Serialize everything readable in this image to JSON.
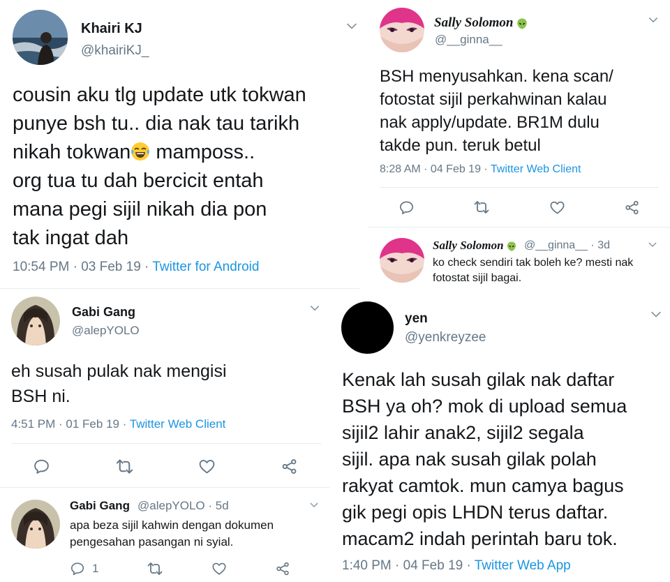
{
  "tweet1": {
    "name": "Khairi KJ",
    "handle": "@khairiKJ_",
    "lines": [
      "cousin aku tlg update utk tokwan",
      "punye bsh tu.. dia nak tau tarikh",
      "nikah tokwan",
      " mamposs..",
      "org tua tu dah bercicit entah",
      "mana pegi sijil nikah dia pon",
      "tak ingat dah"
    ],
    "time": "10:54 PM · 03 Feb 19 · ",
    "source": "Twitter for Android"
  },
  "tweet2": {
    "name": "Sally Solomon",
    "handle": "@__ginna__",
    "lines": [
      "BSH menyusahkan. kena scan/",
      "fotostat sijil perkahwinan kalau",
      "nak apply/update. BR1M dulu",
      "takde pun. teruk betul"
    ],
    "time": "8:28 AM · 04 Feb 19 · ",
    "source": "Twitter Web Client"
  },
  "reply2": {
    "name": "Sally Solomon",
    "meta": "@__ginna__ · 3d",
    "lines": [
      "ko check sendiri tak boleh ke? mesti nak",
      "fotostat sijil bagai."
    ]
  },
  "tweet3": {
    "name": "Gabi Gang",
    "handle": "@alepYOLO",
    "lines": [
      "eh susah pulak nak mengisi",
      "BSH ni."
    ],
    "time": "4:51 PM · 01 Feb 19 · ",
    "source": "Twitter Web Client"
  },
  "reply3": {
    "name": "Gabi Gang",
    "meta": "@alepYOLO · 5d",
    "lines": [
      "apa beza sijil kahwin dengan dokumen",
      "pengesahan pasangan ni syial."
    ],
    "reply_count": "1"
  },
  "tweet4": {
    "name": "yen",
    "handle": "@yenkreyzee",
    "lines": [
      "Kenak lah susah gilak nak daftar",
      "BSH ya oh? mok di upload semua",
      "sijil2 lahir anak2, sijil2 segala",
      "sijil. apa nak susah gilak polah",
      "rakyat camtok. mun camya bagus",
      "gik pegi opis LHDN terus daftar.",
      "macam2 indah perintah baru tok."
    ],
    "time": "1:40 PM · 04 Feb 19 · ",
    "source": "Twitter Web App"
  },
  "colors": {
    "link": "#1b95e0",
    "secondary": "#657786",
    "icon": "#657786"
  },
  "icons": {
    "chevron": "chevron-down-icon",
    "reply": "reply-icon",
    "retweet": "retweet-icon",
    "like": "heart-icon",
    "share": "share-icon",
    "emoji": "laughing-tears-emoji",
    "alien": "alien-emoji"
  }
}
